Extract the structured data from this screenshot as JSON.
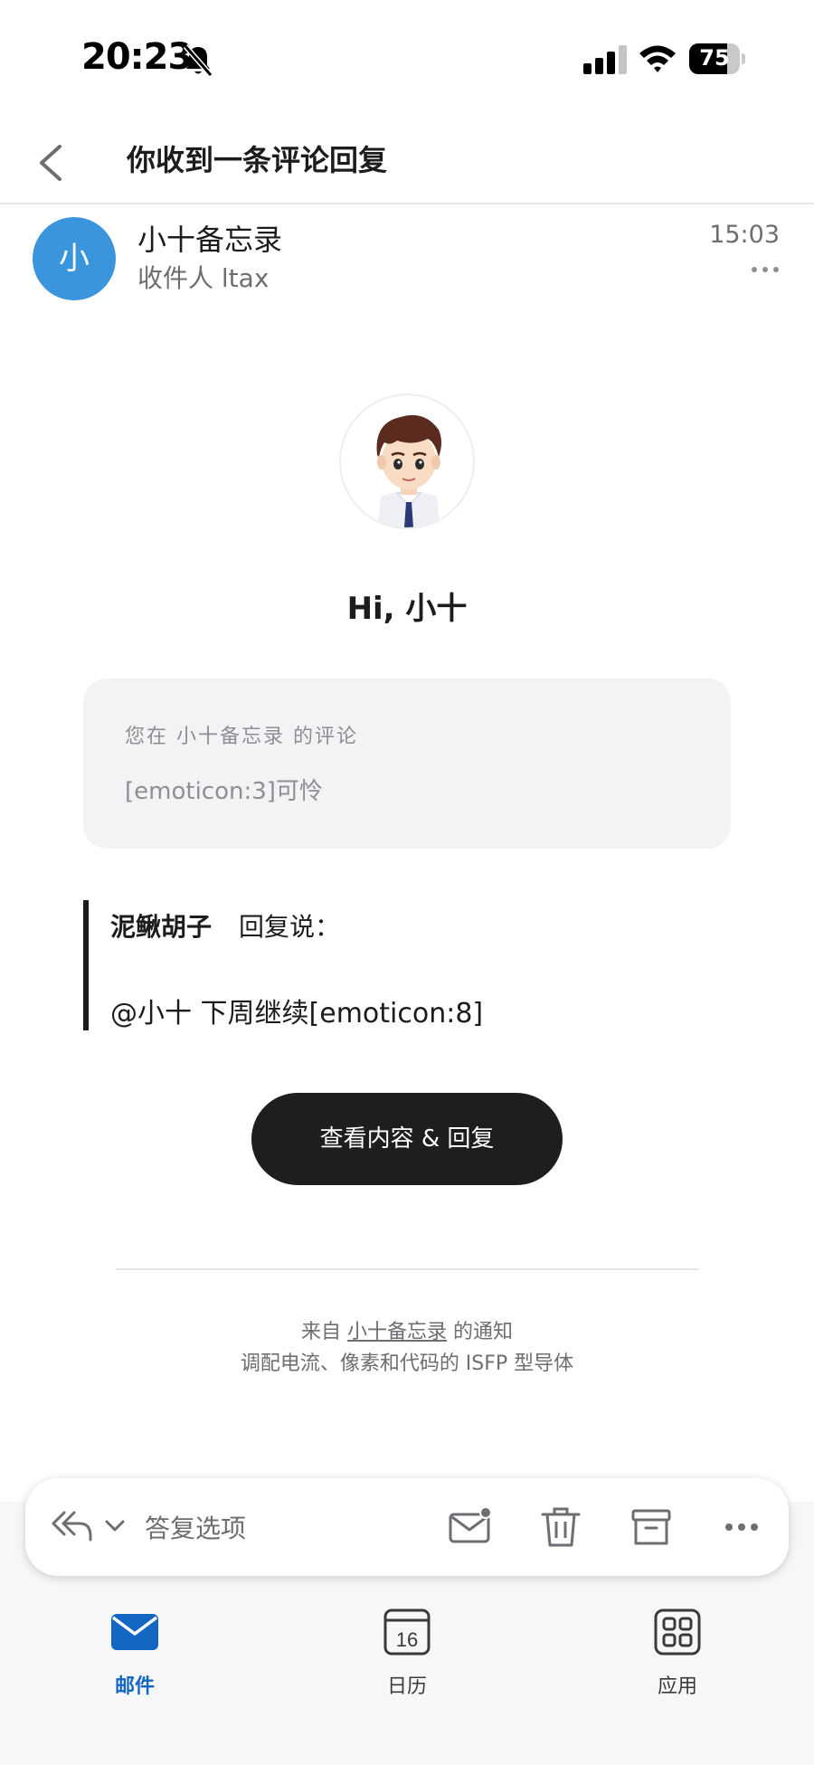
{
  "status_bar": {
    "time": "20:23",
    "battery_level": "75",
    "battery_fraction": 0.75
  },
  "header": {
    "title": "你收到一条评论回复"
  },
  "sender": {
    "avatar_initial": "小",
    "name": "小十备忘录",
    "recipient": "收件人 ltax",
    "time": "15:03"
  },
  "email": {
    "greeting": "Hi, 小十",
    "comment_source": "您在 小十备忘录 的评论",
    "comment_text": "[emoticon:3]可怜",
    "reply_author": "泥鳅胡子",
    "reply_says": "回复说：",
    "reply_text": "@小十 下周继续[emoticon:8]",
    "view_button": "查看内容 & 回复",
    "footer_prefix": "来自",
    "footer_link": "小十备忘录",
    "footer_suffix": "的通知",
    "footer_tagline": "调配电流、像素和代码的 ISFP 型导体"
  },
  "toolbar": {
    "reply_options": "答复选项",
    "icons": [
      "reply-all-icon",
      "chevron-down-icon",
      "mark-unread-icon",
      "trash-icon",
      "archive-icon",
      "more-icon"
    ]
  },
  "tabs": [
    {
      "label": "邮件",
      "icon": "mail-icon",
      "active": true
    },
    {
      "label": "日历",
      "icon": "calendar-icon",
      "calendar_day": "16",
      "active": false
    },
    {
      "label": "应用",
      "icon": "apps-icon",
      "active": false
    }
  ],
  "colors": {
    "accent": "#1466c3",
    "avatar_bg": "#3b95dd",
    "button_bg": "#1e1e20",
    "card_bg": "#f3f3f5"
  }
}
